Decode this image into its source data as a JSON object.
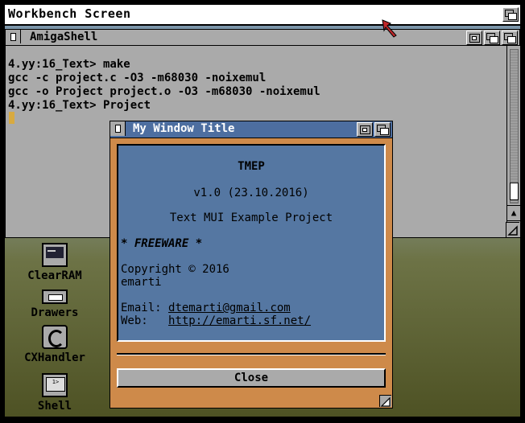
{
  "screen": {
    "title": "Workbench Screen"
  },
  "shell": {
    "title": "AmigaShell",
    "lines": [
      "4.yy:16_Text> make",
      "gcc -c project.c -O3 -m68030 -noixemul",
      "gcc -o Project project.o -O3 -m68030 -noixemul",
      "4.yy:16_Text> Project"
    ]
  },
  "icons": [
    {
      "label": "ClearRAM"
    },
    {
      "label": "Drawers"
    },
    {
      "label": "CXHandler"
    },
    {
      "label": "Shell"
    }
  ],
  "mui_window": {
    "title": "My Window Title",
    "app_name": "TMEP",
    "version": "v1.0 (23.10.2016)",
    "description": "Text MUI Example Project",
    "freeware": "* FREEWARE *",
    "copyright": "Copyright © 2016",
    "author": "emarti",
    "email_label": "Email:",
    "email": "dtemarti@gmail.com",
    "web_label": "Web:",
    "web": "http://emarti.sf.net/",
    "close_label": "Close"
  },
  "colors": {
    "panel": "#5577a2",
    "window_bg": "#ce8a4a",
    "titlebar_active": "#4d6ea0",
    "gray": "#aaaaaa"
  }
}
